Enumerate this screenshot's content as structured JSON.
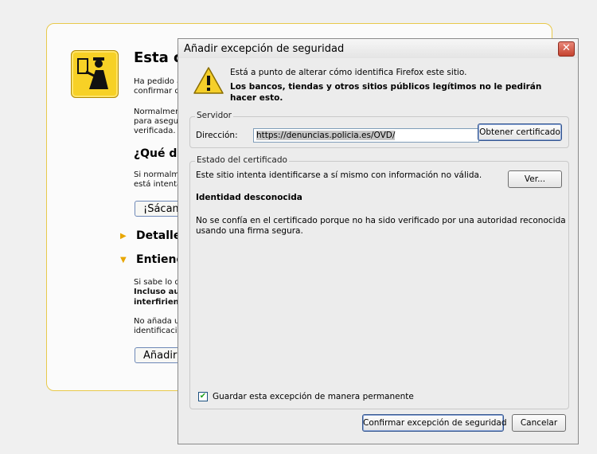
{
  "background_page": {
    "title": "Esta c",
    "intro_text": "Ha pedido a\nconfirmar qu",
    "normal_text": "Normalment\npara asegu\nverificada.",
    "what_heading": "¿Qué de",
    "what_text": "Si normalme\nestá intenta",
    "get_me_out_button": "¡Sácam",
    "details_heading": "Detalles",
    "understand_heading": "Entiend",
    "understand_text_1": "Si sabe lo q",
    "understand_text_2": "Incluso au",
    "understand_text_3": "interfirien",
    "understand_text_4": "No añada u\nidentificació",
    "add_exception_button": "Añadir",
    "arrow_right": "▶",
    "arrow_down": "▼"
  },
  "dialog": {
    "title": "Añadir excepción de seguridad",
    "close_glyph": "✕",
    "warning_line1": "Está a punto de alterar cómo identifica Firefox este sitio.",
    "warning_line2": "Los bancos, tiendas y otros sitios públicos legítimos no le pedirán hacer esto.",
    "server": {
      "legend": "Servidor",
      "address_label": "Dirección:",
      "address_value": "https://denuncias.policia.es/OVD/",
      "get_certificate_button": "Obtener certificado"
    },
    "cert_status": {
      "legend": "Estado del certificado",
      "invalid_info": "Este sitio intenta identificarse a sí mismo con información no válida.",
      "view_button": "Ver...",
      "unknown_identity": "Identidad desconocida",
      "explanation_line1": "No se confía en el certificado porque no ha sido verificado por una autoridad reconocida",
      "explanation_line2": "usando una firma segura.",
      "permanent_label": "Guardar esta excepción de manera permanente",
      "permanent_checked": "✔"
    },
    "confirm_button": "Confirmar excepción de seguridad",
    "cancel_button": "Cancelar"
  }
}
